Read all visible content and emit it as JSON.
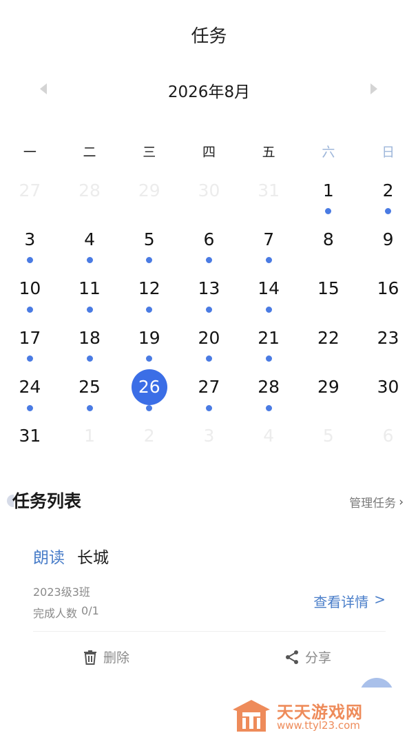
{
  "header": {
    "title": "任务"
  },
  "calendar": {
    "month_label": "2026年8月",
    "weekdays": [
      "一",
      "二",
      "三",
      "四",
      "五",
      "六",
      "日"
    ],
    "weekend_color": "#9db6da",
    "selected_day": "26",
    "accent": "#3b6ee6",
    "weeks": [
      [
        {
          "d": "27",
          "o": true,
          "m": false
        },
        {
          "d": "28",
          "o": true,
          "m": false
        },
        {
          "d": "29",
          "o": true,
          "m": false
        },
        {
          "d": "30",
          "o": true,
          "m": false
        },
        {
          "d": "31",
          "o": true,
          "m": false
        },
        {
          "d": "1",
          "o": false,
          "m": true
        },
        {
          "d": "2",
          "o": false,
          "m": true
        }
      ],
      [
        {
          "d": "3",
          "o": false,
          "m": true
        },
        {
          "d": "4",
          "o": false,
          "m": true
        },
        {
          "d": "5",
          "o": false,
          "m": true
        },
        {
          "d": "6",
          "o": false,
          "m": true
        },
        {
          "d": "7",
          "o": false,
          "m": true
        },
        {
          "d": "8",
          "o": false,
          "m": false
        },
        {
          "d": "9",
          "o": false,
          "m": false
        }
      ],
      [
        {
          "d": "10",
          "o": false,
          "m": true
        },
        {
          "d": "11",
          "o": false,
          "m": true
        },
        {
          "d": "12",
          "o": false,
          "m": true
        },
        {
          "d": "13",
          "o": false,
          "m": true
        },
        {
          "d": "14",
          "o": false,
          "m": true
        },
        {
          "d": "15",
          "o": false,
          "m": false
        },
        {
          "d": "16",
          "o": false,
          "m": false
        }
      ],
      [
        {
          "d": "17",
          "o": false,
          "m": true
        },
        {
          "d": "18",
          "o": false,
          "m": true
        },
        {
          "d": "19",
          "o": false,
          "m": true
        },
        {
          "d": "20",
          "o": false,
          "m": true
        },
        {
          "d": "21",
          "o": false,
          "m": true
        },
        {
          "d": "22",
          "o": false,
          "m": false
        },
        {
          "d": "23",
          "o": false,
          "m": false
        }
      ],
      [
        {
          "d": "24",
          "o": false,
          "m": true
        },
        {
          "d": "25",
          "o": false,
          "m": true
        },
        {
          "d": "26",
          "o": false,
          "m": true
        },
        {
          "d": "27",
          "o": false,
          "m": true
        },
        {
          "d": "28",
          "o": false,
          "m": true
        },
        {
          "d": "29",
          "o": false,
          "m": false
        },
        {
          "d": "30",
          "o": false,
          "m": false
        }
      ],
      [
        {
          "d": "31",
          "o": false,
          "m": false
        },
        {
          "d": "1",
          "o": true,
          "m": false
        },
        {
          "d": "2",
          "o": true,
          "m": false
        },
        {
          "d": "3",
          "o": true,
          "m": false
        },
        {
          "d": "4",
          "o": true,
          "m": false
        },
        {
          "d": "5",
          "o": true,
          "m": false
        },
        {
          "d": "6",
          "o": true,
          "m": false
        }
      ]
    ]
  },
  "task_list": {
    "title": "任务列表",
    "manage_label": "管理任务",
    "manage_chevron": "›",
    "task": {
      "type": "朗读",
      "name": "长城",
      "class_name": "2023级3班",
      "count_label": "完成人数",
      "count_value": "0/1",
      "detail_label": "查看详情",
      "detail_chevron": ">",
      "delete_label": "删除",
      "share_label": "分享"
    }
  },
  "watermark": {
    "name": "天天游戏网",
    "url": "www.ttyl23.com",
    "color": "#ee8b5a"
  }
}
